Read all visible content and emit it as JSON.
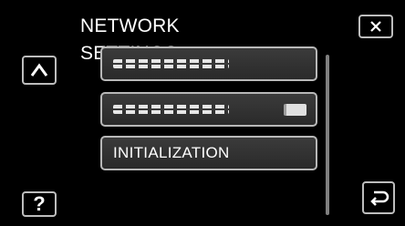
{
  "header": {
    "title": "NETWORK SETTINGS"
  },
  "menu": {
    "items": [
      {
        "label": "",
        "masked": true
      },
      {
        "label": "",
        "masked": true
      },
      {
        "label": "INITIALIZATION",
        "masked": false
      }
    ]
  },
  "buttons": {
    "help_label": "?"
  }
}
